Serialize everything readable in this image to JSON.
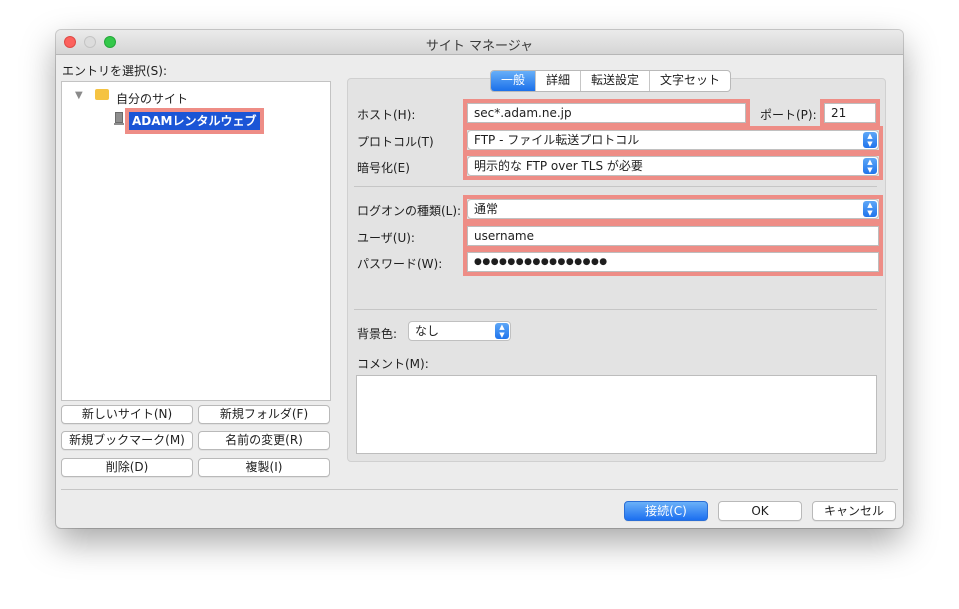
{
  "window": {
    "title": "サイト マネージャ"
  },
  "left": {
    "entries_label": "エントリを選択(S):",
    "tree": {
      "root_label": "自分のサイト",
      "site_label": "ADAMレンタルウェブ"
    },
    "buttons": {
      "new_site": "新しいサイト(N)",
      "new_folder": "新規フォルダ(F)",
      "new_bookmark": "新規ブックマーク(M)",
      "rename": "名前の変更(R)",
      "delete": "削除(D)",
      "duplicate": "複製(I)"
    }
  },
  "tabs": {
    "general": "一般",
    "advanced": "詳細",
    "transfer": "転送設定",
    "charset": "文字セット"
  },
  "form": {
    "host_label": "ホスト(H):",
    "host_value": "sec*.adam.ne.jp",
    "port_label": "ポート(P):",
    "port_value": "21",
    "protocol_label": "プロトコル(T)",
    "protocol_value": "FTP - ファイル転送プロトコル",
    "encryption_label": "暗号化(E)",
    "encryption_value": "明示的な FTP over TLS が必要",
    "logon_label": "ログオンの種類(L):",
    "logon_value": "通常",
    "user_label": "ユーザ(U):",
    "user_value": "username",
    "password_label": "パスワード(W):",
    "password_value": "●●●●●●●●●●●●●●●●",
    "bg_label": "背景色:",
    "bg_value": "なし",
    "comment_label": "コメント(M):"
  },
  "footer": {
    "connect": "接続(C)",
    "ok": "OK",
    "cancel": "キャンセル"
  },
  "colors": {
    "accent": "#1f74ec",
    "highlight": "#ee8d86",
    "window_bg": "#ececec"
  }
}
